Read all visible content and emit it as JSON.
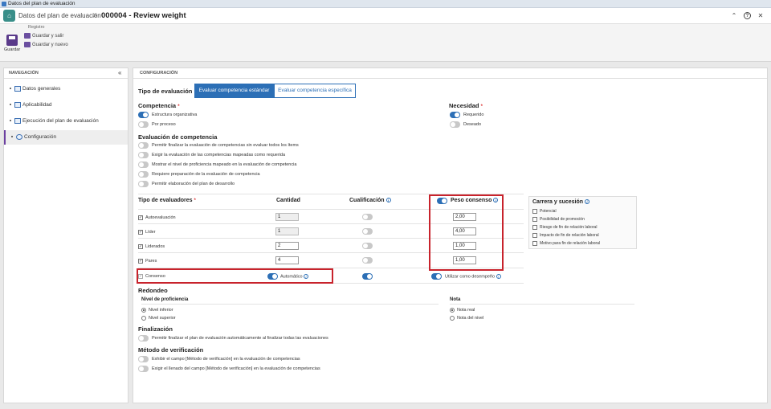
{
  "window": {
    "title": "Datos del plan de evaluación"
  },
  "header": {
    "breadcrumb_parent": "Datos del plan de evaluación",
    "separator": ">",
    "record_title": "000004 - Review weight"
  },
  "ribbon": {
    "group_label": "Registro",
    "save_label": "Guardar",
    "save_exit_label": "Guardar y salir",
    "save_new_label": "Guardar y nuevo"
  },
  "sidebar": {
    "title": "NAVEGACIÓN",
    "collapse_icon": "«",
    "items": [
      {
        "label": "Datos generales"
      },
      {
        "label": "Aplicabilidad"
      },
      {
        "label": "Ejecución del plan de evaluación"
      },
      {
        "label": "Configuración"
      }
    ]
  },
  "main": {
    "section_title": "CONFIGURACIÓN",
    "tipo_label": "Tipo de evaluación",
    "tipo_options": [
      "Evaluar competencia estándar",
      "Evaluar competencia específica"
    ],
    "competencia": {
      "title": "Competencia",
      "req": "*",
      "opts": [
        {
          "label": "Estructura organizativa",
          "on": true
        },
        {
          "label": "Por proceso",
          "on": false
        }
      ]
    },
    "necesidad": {
      "title": "Necesidad",
      "req": "*",
      "opts": [
        {
          "label": "Requerido",
          "on": true
        },
        {
          "label": "Deseado",
          "on": false
        }
      ]
    },
    "evaluacion": {
      "title": "Evaluación de competencia",
      "opts": [
        {
          "label": "Permitir finalizar la evaluación de competencias sin evaluar todos los ítems"
        },
        {
          "label": "Exigir la evaluación de las competencias mapeadas como requerida"
        },
        {
          "label": "Mostrar el nivel de proficiencia mapeado en la evaluación de competencia"
        },
        {
          "label": "Requiere preparación de la evaluación de competencia"
        },
        {
          "label": "Permitir elaboración del plan de desarrollo"
        }
      ]
    },
    "table": {
      "header_tipo": "Tipo de evaluadores",
      "req": "*",
      "header_cantidad": "Cantidad",
      "header_cualificacion": "Cualificación",
      "header_peso": "Peso consenso",
      "rows": [
        {
          "label": "Autoevaluación",
          "cantidad": "1",
          "peso": "2,00"
        },
        {
          "label": "Líder",
          "cantidad": "1",
          "peso": "4,00"
        },
        {
          "label": "Liderados",
          "cantidad": "2",
          "peso": "1,00"
        },
        {
          "label": "Pares",
          "cantidad": "4",
          "peso": "1,00"
        }
      ],
      "consenso": {
        "label": "Consenso",
        "auto_label": "Automático",
        "utilizar_label": "Utilizar como desempeño"
      }
    },
    "carrera": {
      "title": "Carrera y sucesión",
      "items": [
        "Potencial",
        "Posibilidad de promoción",
        "Riesgo de fin de relación laboral",
        "Impacto de fin de relación laboral",
        "Motivo para fin de relación laboral"
      ]
    },
    "redondeo": {
      "title": "Redondeo",
      "nivel_title": "Nivel de proficiencia",
      "nivel_opts": [
        "Nivel inferior",
        "Nivel superior"
      ],
      "nota_title": "Nota",
      "nota_opts": [
        "Nota real",
        "Nota del nivel"
      ]
    },
    "finalizacion": {
      "title": "Finalización",
      "opt": "Permitir finalizar el plan de evaluación automáticamente al finalizar todas las evaluaciones"
    },
    "metodo": {
      "title": "Método de verificación",
      "opts": [
        "Exhibir el campo [Método de verificación] en la evaluación de competencias",
        "Exigir el llenado del campo [Método de verificación] en la evaluación de competencias"
      ]
    }
  }
}
